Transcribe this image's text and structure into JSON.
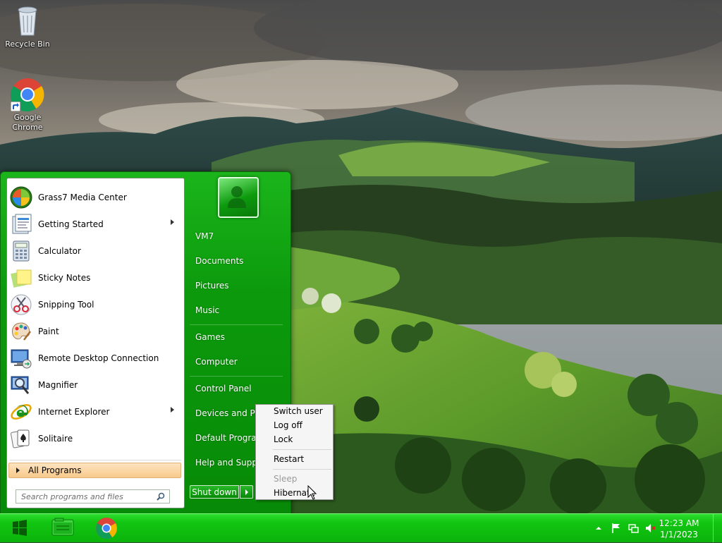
{
  "desktop": {
    "icons": [
      {
        "label": "Recycle Bin"
      },
      {
        "label": "Google Chrome"
      }
    ]
  },
  "start_menu": {
    "programs": [
      {
        "label": "Grass7 Media Center",
        "icon": "media-center-icon",
        "has_submenu": false
      },
      {
        "label": "Getting Started",
        "icon": "getting-started-icon",
        "has_submenu": true
      },
      {
        "label": "Calculator",
        "icon": "calculator-icon",
        "has_submenu": false
      },
      {
        "label": "Sticky Notes",
        "icon": "sticky-notes-icon",
        "has_submenu": false
      },
      {
        "label": "Snipping Tool",
        "icon": "scissors-icon",
        "has_submenu": false
      },
      {
        "label": "Paint",
        "icon": "paint-palette-icon",
        "has_submenu": false
      },
      {
        "label": "Remote Desktop Connection",
        "icon": "remote-desktop-icon",
        "has_submenu": false
      },
      {
        "label": "Magnifier",
        "icon": "magnifier-icon",
        "has_submenu": false
      },
      {
        "label": "Internet Explorer",
        "icon": "internet-explorer-icon",
        "has_submenu": true
      },
      {
        "label": "Solitaire",
        "icon": "solitaire-icon",
        "has_submenu": false
      }
    ],
    "all_programs_label": "All Programs",
    "search_placeholder": "Search programs and files",
    "right_items": [
      {
        "label": "VM7"
      },
      {
        "label": "Documents"
      },
      {
        "label": "Pictures"
      },
      {
        "label": "Music"
      },
      {
        "label": "Games"
      },
      {
        "label": "Computer"
      },
      {
        "label": "Control Panel"
      },
      {
        "label": "Devices and Printers"
      },
      {
        "label": "Default Programs"
      },
      {
        "label": "Help and Support"
      }
    ],
    "shutdown_label": "Shut down"
  },
  "shutdown_menu": {
    "items": [
      {
        "label": "Switch user",
        "enabled": true
      },
      {
        "label": "Log off",
        "enabled": true
      },
      {
        "label": "Lock",
        "enabled": true
      },
      {
        "label": "Restart",
        "enabled": true
      },
      {
        "label": "Sleep",
        "enabled": false
      },
      {
        "label": "Hibernate",
        "enabled": true
      }
    ]
  },
  "taskbar": {
    "pinned": [
      {
        "name": "start-orb-icon"
      },
      {
        "name": "file-explorer-icon"
      },
      {
        "name": "chrome-icon"
      }
    ],
    "tray_icons": [
      "show-hidden-icons-chevron",
      "action-center-flag-icon",
      "network-icon",
      "volume-muted-icon"
    ],
    "clock": {
      "time": "12:23 AM",
      "date": "1/1/2023"
    }
  },
  "colors": {
    "accent": "#0c9a0c",
    "taskbar": "#12c512",
    "all_programs_highlight": "#f8c98b"
  }
}
